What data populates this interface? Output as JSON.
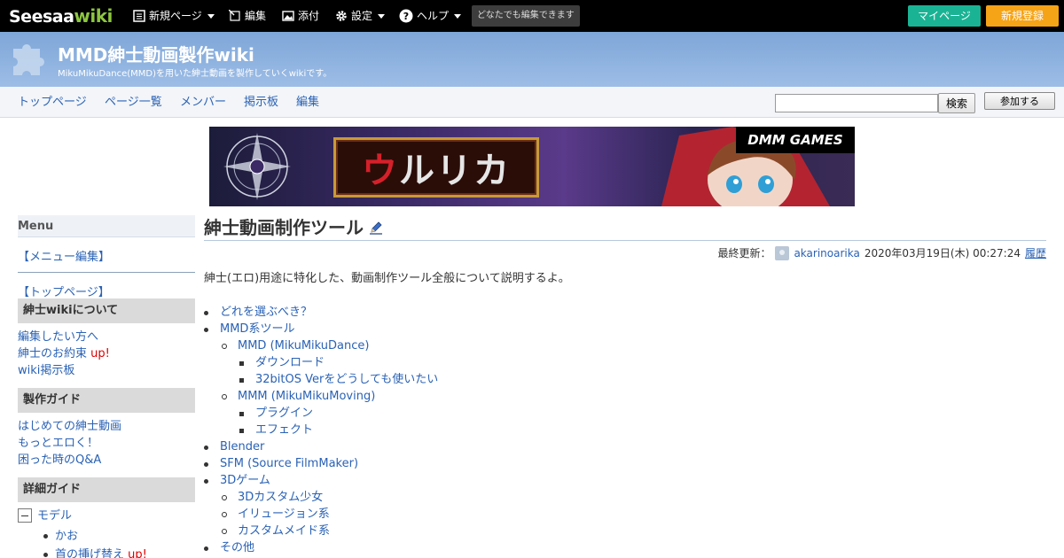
{
  "topbar": {
    "logo_main": "Seesaa",
    "logo_wiki": "wiki",
    "new_page": "新規ページ",
    "edit": "編集",
    "attach": "添付",
    "settings": "設定",
    "help": "ヘルプ",
    "editable_badge": "どなたでも編集できます",
    "mypage": "マイページ",
    "signup": "新規登録"
  },
  "header": {
    "title": "MMD紳士動画製作wiki",
    "subtitle": "MikuMikuDance(MMD)を用いた紳士動画を製作していくwikiです。"
  },
  "nav": {
    "items": [
      "トップページ",
      "ページ一覧",
      "メンバー",
      "掲示板",
      "編集"
    ],
    "search_value": "",
    "search_button": "検索",
    "join_button": "参加する"
  },
  "banner": {
    "logo_text_red": "ウ",
    "logo_text_rest": "ルリカ",
    "brand": "DMM GAMES"
  },
  "sidebar": {
    "menu_title": "Menu",
    "menu_edit": "【メニュー編集】",
    "top_link": "【トップページ】",
    "sections": [
      {
        "title": "紳士wikiについて",
        "links": [
          "編集したい方へ",
          "紳士のお約束",
          "wiki掲示板"
        ]
      },
      {
        "title": "製作ガイド",
        "links": [
          "はじめての紳士動画",
          "もっとエロく！",
          "困った時のQ&A"
        ]
      },
      {
        "title": "詳細ガイド"
      }
    ],
    "up_label": "up!",
    "tree_root": "モデル",
    "tree_children": [
      "かお",
      "首の挿げ替え"
    ]
  },
  "main": {
    "title": "紳士動画制作ツール",
    "last_updated_label": "最終更新：",
    "author": "akarinoarika",
    "timestamp": "2020年03月19日(木) 00:27:24",
    "history": "履歴",
    "intro": "紳士(エロ)用途に特化した、動画制作ツール全般について説明するよ。",
    "toc": {
      "l1_which": "どれを選ぶべき？",
      "l1_mmd_tools": "MMD系ツール",
      "l2_mmd": "MMD (MikuMikuDance)",
      "l3_download": "ダウンロード",
      "l3_32bit": "32bitOS Verをどうしても使いたい",
      "l2_mmm": "MMM (MikuMikuMoving)",
      "l3_plugin": "プラグイン",
      "l3_effect": "エフェクト",
      "l1_blender": "Blender",
      "l1_sfm": "SFM (Source FilmMaker)",
      "l1_3dgame": "3Dゲーム",
      "l2_3dcustom": "3Dカスタム少女",
      "l2_illusion": "イリュージョン系",
      "l2_custommaid": "カスタムメイド系",
      "l1_other": "その他"
    }
  }
}
